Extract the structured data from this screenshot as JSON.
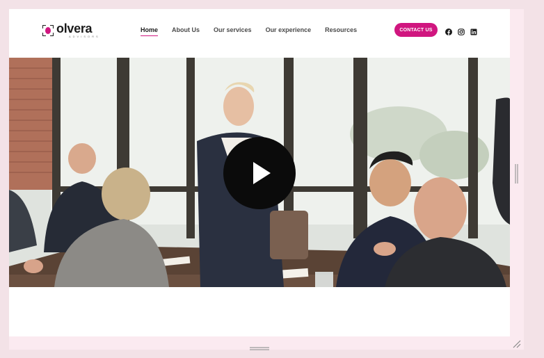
{
  "brand": {
    "name": "olvera",
    "tagline": "ADVISORS",
    "accent": "#d0167f"
  },
  "nav": {
    "items": [
      {
        "label": "Home",
        "active": true
      },
      {
        "label": "About Us",
        "active": false
      },
      {
        "label": "Our services",
        "active": false
      },
      {
        "label": "Our experience",
        "active": false
      },
      {
        "label": "Resources",
        "active": false
      }
    ]
  },
  "header": {
    "contact_label": "CONTACT US"
  },
  "socials": {
    "icons": [
      "facebook-icon",
      "instagram-icon",
      "linkedin-icon"
    ]
  },
  "hero": {
    "image_subject": "business meeting with presenter standing at conference table",
    "play_icon": "play-icon"
  }
}
